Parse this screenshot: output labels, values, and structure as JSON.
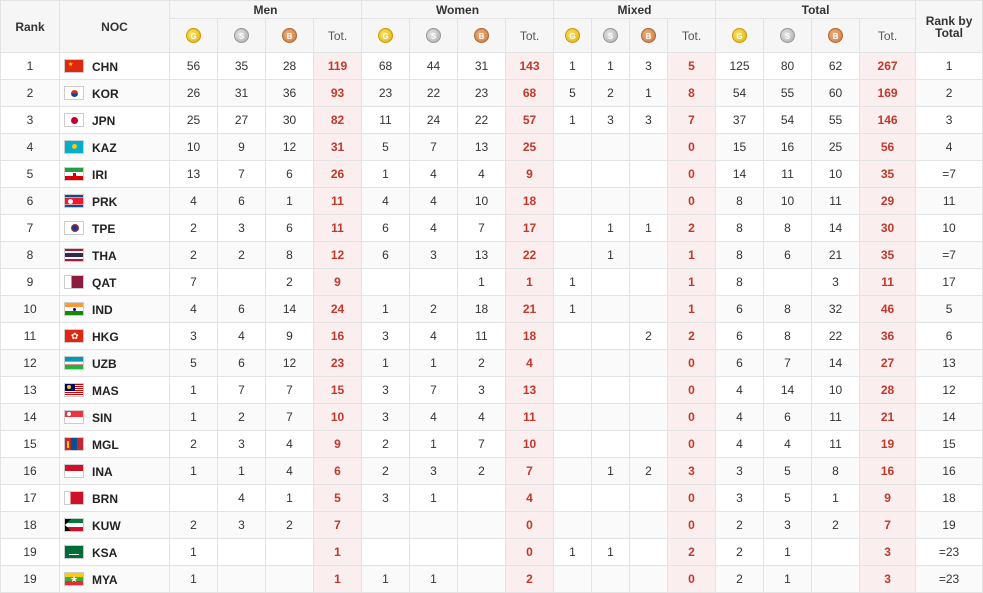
{
  "headers": {
    "rank": "Rank",
    "noc": "NOC",
    "men": "Men",
    "women": "Women",
    "mixed": "Mixed",
    "total": "Total",
    "rank_by_total": "Rank by Total",
    "tot": "Tot.",
    "gold_glyph": "G",
    "silver_glyph": "S",
    "bronze_glyph": "B"
  },
  "colors": {
    "gold": "#e2ab00",
    "silver": "#a9a9a9",
    "bronze": "#c9773c",
    "total_text": "#c0392b",
    "total_bg": "#fbeeee"
  },
  "rows": [
    {
      "rank": "1",
      "noc": "CHN",
      "flag": "chn",
      "men": [
        "56",
        "35",
        "28",
        "119"
      ],
      "women": [
        "68",
        "44",
        "31",
        "143"
      ],
      "mixed": [
        "1",
        "1",
        "3",
        "5"
      ],
      "total": [
        "125",
        "80",
        "62",
        "267"
      ],
      "rbt": "1"
    },
    {
      "rank": "2",
      "noc": "KOR",
      "flag": "kor",
      "men": [
        "26",
        "31",
        "36",
        "93"
      ],
      "women": [
        "23",
        "22",
        "23",
        "68"
      ],
      "mixed": [
        "5",
        "2",
        "1",
        "8"
      ],
      "total": [
        "54",
        "55",
        "60",
        "169"
      ],
      "rbt": "2"
    },
    {
      "rank": "3",
      "noc": "JPN",
      "flag": "jpn",
      "men": [
        "25",
        "27",
        "30",
        "82"
      ],
      "women": [
        "11",
        "24",
        "22",
        "57"
      ],
      "mixed": [
        "1",
        "3",
        "3",
        "7"
      ],
      "total": [
        "37",
        "54",
        "55",
        "146"
      ],
      "rbt": "3"
    },
    {
      "rank": "4",
      "noc": "KAZ",
      "flag": "kaz",
      "men": [
        "10",
        "9",
        "12",
        "31"
      ],
      "women": [
        "5",
        "7",
        "13",
        "25"
      ],
      "mixed": [
        "",
        "",
        "",
        "0"
      ],
      "total": [
        "15",
        "16",
        "25",
        "56"
      ],
      "rbt": "4"
    },
    {
      "rank": "5",
      "noc": "IRI",
      "flag": "iri",
      "men": [
        "13",
        "7",
        "6",
        "26"
      ],
      "women": [
        "1",
        "4",
        "4",
        "9"
      ],
      "mixed": [
        "",
        "",
        "",
        "0"
      ],
      "total": [
        "14",
        "11",
        "10",
        "35"
      ],
      "rbt": "=7"
    },
    {
      "rank": "6",
      "noc": "PRK",
      "flag": "prk",
      "men": [
        "4",
        "6",
        "1",
        "11"
      ],
      "women": [
        "4",
        "4",
        "10",
        "18"
      ],
      "mixed": [
        "",
        "",
        "",
        "0"
      ],
      "total": [
        "8",
        "10",
        "11",
        "29"
      ],
      "rbt": "11"
    },
    {
      "rank": "7",
      "noc": "TPE",
      "flag": "tpe",
      "men": [
        "2",
        "3",
        "6",
        "11"
      ],
      "women": [
        "6",
        "4",
        "7",
        "17"
      ],
      "mixed": [
        "",
        "1",
        "1",
        "2"
      ],
      "total": [
        "8",
        "8",
        "14",
        "30"
      ],
      "rbt": "10"
    },
    {
      "rank": "8",
      "noc": "THA",
      "flag": "tha",
      "men": [
        "2",
        "2",
        "8",
        "12"
      ],
      "women": [
        "6",
        "3",
        "13",
        "22"
      ],
      "mixed": [
        "",
        "1",
        "",
        "1"
      ],
      "total": [
        "8",
        "6",
        "21",
        "35"
      ],
      "rbt": "=7"
    },
    {
      "rank": "9",
      "noc": "QAT",
      "flag": "qat",
      "men": [
        "7",
        "",
        "2",
        "9"
      ],
      "women": [
        "",
        "",
        "1",
        "1"
      ],
      "mixed": [
        "1",
        "",
        "",
        "1"
      ],
      "total": [
        "8",
        "",
        "3",
        "11"
      ],
      "rbt": "17"
    },
    {
      "rank": "10",
      "noc": "IND",
      "flag": "ind",
      "men": [
        "4",
        "6",
        "14",
        "24"
      ],
      "women": [
        "1",
        "2",
        "18",
        "21"
      ],
      "mixed": [
        "1",
        "",
        "",
        "1"
      ],
      "total": [
        "6",
        "8",
        "32",
        "46"
      ],
      "rbt": "5"
    },
    {
      "rank": "11",
      "noc": "HKG",
      "flag": "hkg",
      "men": [
        "3",
        "4",
        "9",
        "16"
      ],
      "women": [
        "3",
        "4",
        "11",
        "18"
      ],
      "mixed": [
        "",
        "",
        "2",
        "2"
      ],
      "total": [
        "6",
        "8",
        "22",
        "36"
      ],
      "rbt": "6"
    },
    {
      "rank": "12",
      "noc": "UZB",
      "flag": "uzb",
      "men": [
        "5",
        "6",
        "12",
        "23"
      ],
      "women": [
        "1",
        "1",
        "2",
        "4"
      ],
      "mixed": [
        "",
        "",
        "",
        "0"
      ],
      "total": [
        "6",
        "7",
        "14",
        "27"
      ],
      "rbt": "13"
    },
    {
      "rank": "13",
      "noc": "MAS",
      "flag": "mas",
      "men": [
        "1",
        "7",
        "7",
        "15"
      ],
      "women": [
        "3",
        "7",
        "3",
        "13"
      ],
      "mixed": [
        "",
        "",
        "",
        "0"
      ],
      "total": [
        "4",
        "14",
        "10",
        "28"
      ],
      "rbt": "12"
    },
    {
      "rank": "14",
      "noc": "SIN",
      "flag": "sin",
      "men": [
        "1",
        "2",
        "7",
        "10"
      ],
      "women": [
        "3",
        "4",
        "4",
        "11"
      ],
      "mixed": [
        "",
        "",
        "",
        "0"
      ],
      "total": [
        "4",
        "6",
        "11",
        "21"
      ],
      "rbt": "14"
    },
    {
      "rank": "15",
      "noc": "MGL",
      "flag": "mgl",
      "men": [
        "2",
        "3",
        "4",
        "9"
      ],
      "women": [
        "2",
        "1",
        "7",
        "10"
      ],
      "mixed": [
        "",
        "",
        "",
        "0"
      ],
      "total": [
        "4",
        "4",
        "11",
        "19"
      ],
      "rbt": "15"
    },
    {
      "rank": "16",
      "noc": "INA",
      "flag": "ina",
      "men": [
        "1",
        "1",
        "4",
        "6"
      ],
      "women": [
        "2",
        "3",
        "2",
        "7"
      ],
      "mixed": [
        "",
        "1",
        "2",
        "3"
      ],
      "total": [
        "3",
        "5",
        "8",
        "16"
      ],
      "rbt": "16"
    },
    {
      "rank": "17",
      "noc": "BRN",
      "flag": "brn",
      "men": [
        "",
        "4",
        "1",
        "5"
      ],
      "women": [
        "3",
        "1",
        "",
        "4"
      ],
      "mixed": [
        "",
        "",
        "",
        "0"
      ],
      "total": [
        "3",
        "5",
        "1",
        "9"
      ],
      "rbt": "18"
    },
    {
      "rank": "18",
      "noc": "KUW",
      "flag": "kuw",
      "men": [
        "2",
        "3",
        "2",
        "7"
      ],
      "women": [
        "",
        "",
        "",
        "0"
      ],
      "mixed": [
        "",
        "",
        "",
        "0"
      ],
      "total": [
        "2",
        "3",
        "2",
        "7"
      ],
      "rbt": "19"
    },
    {
      "rank": "19",
      "noc": "KSA",
      "flag": "ksa",
      "men": [
        "1",
        "",
        "",
        "1"
      ],
      "women": [
        "",
        "",
        "",
        "0"
      ],
      "mixed": [
        "1",
        "1",
        "",
        "2"
      ],
      "total": [
        "2",
        "1",
        "",
        "3"
      ],
      "rbt": "=23"
    },
    {
      "rank": "19",
      "noc": "MYA",
      "flag": "mya",
      "men": [
        "1",
        "",
        "",
        "1"
      ],
      "women": [
        "1",
        "1",
        "",
        "2"
      ],
      "mixed": [
        "",
        "",
        "",
        "0"
      ],
      "total": [
        "2",
        "1",
        "",
        "3"
      ],
      "rbt": "=23"
    }
  ]
}
